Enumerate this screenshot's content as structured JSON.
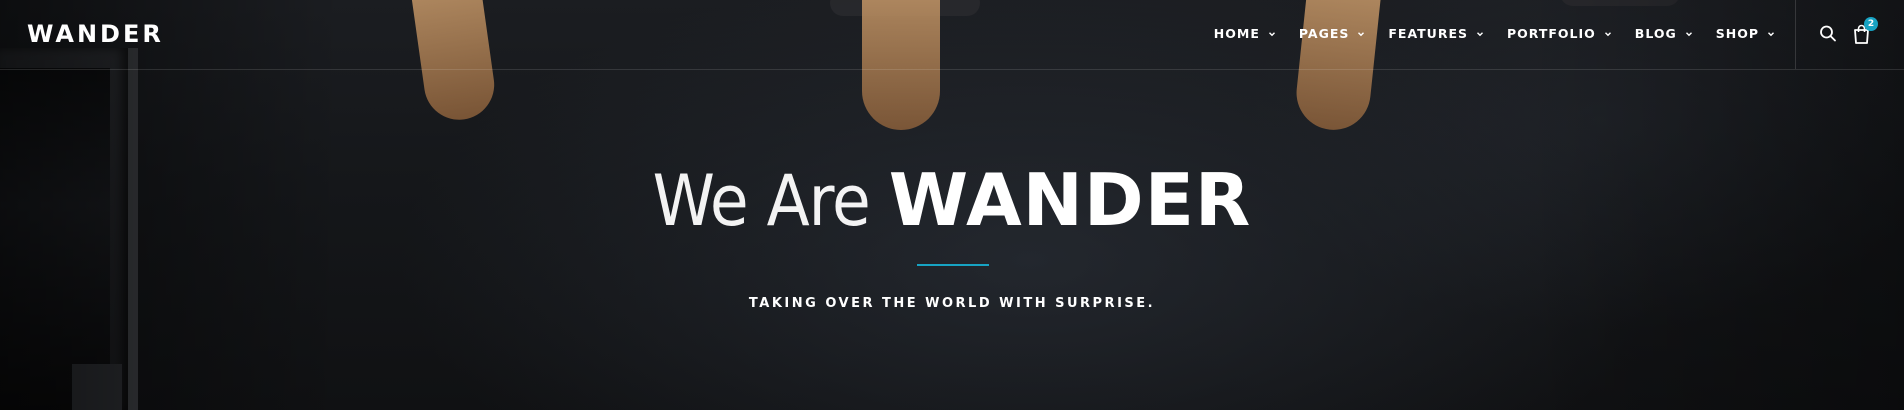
{
  "brand": {
    "logo_text": "WANDER"
  },
  "nav": {
    "items": [
      {
        "label": "HOME"
      },
      {
        "label": "PAGES"
      },
      {
        "label": "FEATURES"
      },
      {
        "label": "PORTFOLIO"
      },
      {
        "label": "BLOG"
      },
      {
        "label": "SHOP"
      }
    ]
  },
  "header_actions": {
    "search_icon": "search-icon",
    "cart_icon": "shopping-bag-icon",
    "cart_count": "2"
  },
  "hero": {
    "headline_light": "We Are",
    "headline_bold": "WANDER",
    "tagline": "TAKING OVER THE WORLD WITH SURPRISE."
  },
  "colors": {
    "accent": "#17a3c3",
    "text": "#ffffff",
    "background": "#15171a"
  }
}
